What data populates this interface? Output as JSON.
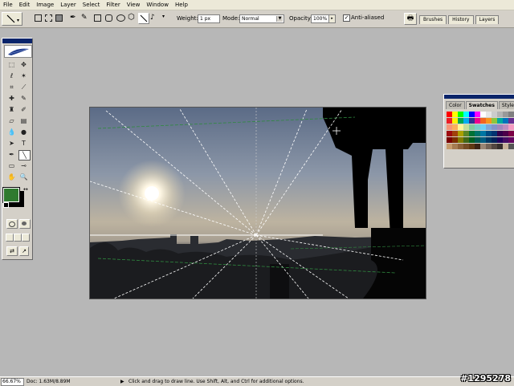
{
  "menu": [
    "File",
    "Edit",
    "Image",
    "Layer",
    "Select",
    "Filter",
    "View",
    "Window",
    "Help"
  ],
  "options": {
    "weight_label": "Weight:",
    "weight_value": "1 px",
    "mode_label": "Mode:",
    "mode_value": "Normal",
    "opacity_label": "Opacity:",
    "opacity_value": "100%",
    "antialias_label": "Anti-aliased",
    "antialias_checked": true
  },
  "palette_tabs": [
    "Brushes",
    "History",
    "Layers"
  ],
  "swatches_panel": {
    "tabs": [
      "Color",
      "Swatches",
      "Style"
    ],
    "active_tab": "Swatches",
    "colors": [
      "#ff0000",
      "#ffff00",
      "#00ff00",
      "#00ffff",
      "#0000ff",
      "#ff00ff",
      "#ffffff",
      "#e6e6e6",
      "#cccccc",
      "#b3b3b3",
      "#999999",
      "#808080",
      "#ed1c24",
      "#fff200",
      "#00a651",
      "#00aeef",
      "#2e3192",
      "#ec008c",
      "#f26522",
      "#f7941d",
      "#8dc63f",
      "#00a99d",
      "#0072bc",
      "#662d91",
      "#f69679",
      "#fbaf5d",
      "#fff799",
      "#c4df9b",
      "#82ca9c",
      "#7accc8",
      "#6dcff6",
      "#7da7d9",
      "#8393ca",
      "#a187be",
      "#bd8cbf",
      "#f49ac1",
      "#9e0b0f",
      "#a0410d",
      "#aba000",
      "#598527",
      "#007236",
      "#00746b",
      "#0076a3",
      "#004a80",
      "#003471",
      "#32004b",
      "#4b0049",
      "#7b0046",
      "#790000",
      "#7b2e00",
      "#827b00",
      "#406618",
      "#005e20",
      "#005952",
      "#005b7f",
      "#003663",
      "#002157",
      "#21005b",
      "#440e62",
      "#630460",
      "#c69c6d",
      "#a67c52",
      "#8c6239",
      "#754c24",
      "#603913",
      "#3c2415",
      "#998675",
      "#736357",
      "#534741",
      "#362f2d",
      "#c7b299",
      "#555555"
    ]
  },
  "toolbox": {
    "foreground_color": "#2f7a2f",
    "background_color": "#000000",
    "tools": [
      "rectangular-marquee",
      "move",
      "lasso",
      "magic-wand",
      "crop",
      "slice",
      "healing-brush",
      "brush",
      "clone-stamp",
      "history-brush",
      "eraser",
      "gradient",
      "blur",
      "dodge",
      "path-selection",
      "type",
      "pen",
      "line",
      "notes",
      "eyedropper",
      "hand",
      "zoom"
    ]
  },
  "status": {
    "zoom": "66.67%",
    "doc": "Doc: 1.63M/8.89M",
    "hint": "Click and drag to draw line.  Use Shift, Alt, and Ctrl for additional options."
  },
  "watermark": "#1295278"
}
